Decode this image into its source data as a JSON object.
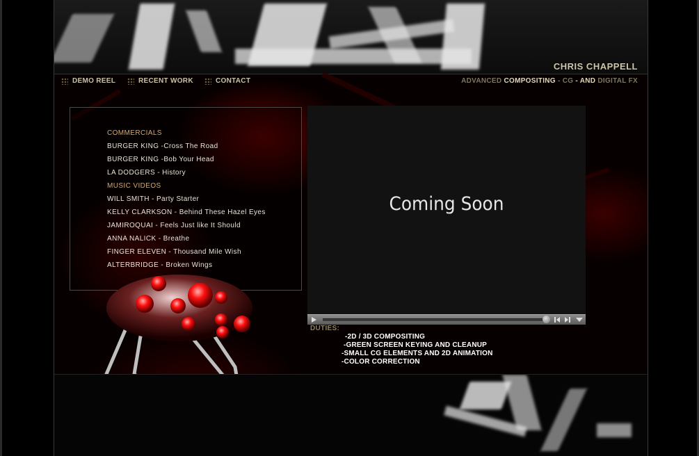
{
  "header": {
    "brand": "CHRIS CHAPPELL",
    "tagline": [
      {
        "text": "ADVANCED ",
        "style": "dim"
      },
      {
        "text": "COMPOSITING",
        "style": "bright"
      },
      {
        "text": " - ",
        "style": "dim"
      },
      {
        "text": "CG",
        "style": "dim"
      },
      {
        "text": " - AND ",
        "style": "bright"
      },
      {
        "text": "DIGITAL FX",
        "style": "dim"
      }
    ]
  },
  "nav": {
    "items": [
      "DEMO REEL",
      "RECENT WORK",
      "CONTACT"
    ]
  },
  "work_list": {
    "items": [
      {
        "label": "COMMERCIALS",
        "type": "heading"
      },
      {
        "label": "BURGER KING -Cross The Road",
        "type": "item"
      },
      {
        "label": "BURGER KING -Bob Your Head",
        "type": "item"
      },
      {
        "label": "LA DODGERS - History",
        "type": "item"
      },
      {
        "label": "MUSIC VIDEOS",
        "type": "heading"
      },
      {
        "label": "WILL SMITH - Party Starter",
        "type": "item"
      },
      {
        "label": "KELLY CLARKSON - Behind These Hazel Eyes",
        "type": "item"
      },
      {
        "label": "JAMIROQUAI - Feels Just like It Should",
        "type": "item"
      },
      {
        "label": "ANNA NALICK  - Breathe",
        "type": "item"
      },
      {
        "label": "FINGER ELEVEN - Thousand Mile Wish",
        "type": "item"
      },
      {
        "label": "ALTERBRIDGE - Broken Wings",
        "type": "item"
      }
    ]
  },
  "video": {
    "message": "Coming Soon",
    "progress": 1.0,
    "icons": [
      "play-icon",
      "rewind-icon",
      "fast-forward-icon",
      "menu-dropdown-icon"
    ]
  },
  "duties": {
    "label": "DUTIES:",
    "items": [
      "-2D / 3D COMPOSITING",
      "-GREEN SCREEN KEYING AND CLEANUP",
      "-SMALL CG ELEMENTS AND 2D ANIMATION",
      "-COLOR CORRECTION"
    ]
  },
  "colors": {
    "accent_heading": "#d9a86a",
    "brand_text": "#cfc7a8",
    "background": "#000000"
  }
}
